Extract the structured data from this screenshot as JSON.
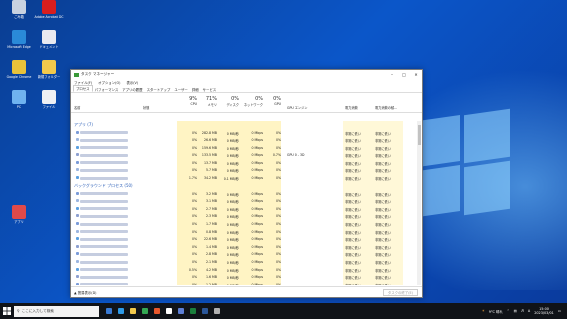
{
  "desktop": {
    "icons": [
      {
        "label": "ごみ箱",
        "color": "#c8d2e0"
      },
      {
        "label": "Adobe Acrobat DC",
        "color": "#d81e1e"
      },
      {
        "label": "Microsoft Edge",
        "color": "#2a8ad8"
      },
      {
        "label": "ドキュメント",
        "color": "#e9eaf0"
      },
      {
        "label": "Google Chrome",
        "color": "#e8c23a"
      },
      {
        "label": "新規フォルダー",
        "color": "#f2c94c"
      },
      {
        "label": "PC",
        "color": "#6fb3f0"
      },
      {
        "label": "アプリ",
        "color": "#e04a4a"
      },
      {
        "label": "ファイル",
        "color": "#eef0f4"
      }
    ]
  },
  "task_manager": {
    "title": "タスク マネージャー",
    "menu": [
      "ファイル(F)",
      "オプション(O)",
      "表示(V)"
    ],
    "tabs": [
      "プロセス",
      "パフォーマンス",
      "アプリの履歴",
      "スタートアップ",
      "ユーザー",
      "詳細",
      "サービス"
    ],
    "columns": {
      "name": "名前",
      "status": "状態",
      "cpu": {
        "pct": "9%",
        "label": "CPU"
      },
      "mem": {
        "pct": "71%",
        "label": "メモリ"
      },
      "disk": {
        "pct": "0%",
        "label": "ディスク"
      },
      "net": {
        "pct": "0%",
        "label": "ネットワーク"
      },
      "gpu": {
        "pct": "0%",
        "label": "GPU"
      },
      "gpu_engine": "GPU エンジン",
      "power": "電力消費",
      "power_trend": "電力消費の傾..."
    },
    "apps_section": "アプリ (7)",
    "bg_section": "バックグラウンド プロセス (50)",
    "app_rows": [
      {
        "cpu": "0%",
        "mem": "282.8 MB",
        "disk": "0 MB/秒",
        "net": "0 Mbps",
        "gpu": "0%",
        "engine": "",
        "power": "非常に低い",
        "trend": "非常に低い"
      },
      {
        "cpu": "0%",
        "mem": "26.6 MB",
        "disk": "0 MB/秒",
        "net": "0 Mbps",
        "gpu": "0%",
        "engine": "",
        "power": "非常に低い",
        "trend": "非常に低い"
      },
      {
        "cpu": "0%",
        "mem": "159.6 MB",
        "disk": "0 MB/秒",
        "net": "0 Mbps",
        "gpu": "0%",
        "engine": "",
        "power": "非常に低い",
        "trend": "非常に低い"
      },
      {
        "cpu": "0%",
        "mem": "133.5 MB",
        "disk": "0 MB/秒",
        "net": "0 Mbps",
        "gpu": "0.7%",
        "engine": "GPU 0 - 3D",
        "power": "非常に低い",
        "trend": "非常に低い"
      },
      {
        "cpu": "0%",
        "mem": "13.7 MB",
        "disk": "0 MB/秒",
        "net": "0 Mbps",
        "gpu": "0%",
        "engine": "",
        "power": "非常に低い",
        "trend": "非常に低い"
      },
      {
        "cpu": "0%",
        "mem": "5.7 MB",
        "disk": "0 MB/秒",
        "net": "0 Mbps",
        "gpu": "0%",
        "engine": "",
        "power": "非常に低い",
        "trend": "非常に低い"
      },
      {
        "cpu": "1.7%",
        "mem": "34.2 MB",
        "disk": "0.1 MB/秒",
        "net": "0 Mbps",
        "gpu": "0%",
        "engine": "",
        "power": "非常に低い",
        "trend": "非常に低い"
      }
    ],
    "bg_rows": [
      {
        "cpu": "0%",
        "mem": "3.2 MB",
        "disk": "0 MB/秒",
        "net": "0 Mbps",
        "gpu": "0%",
        "power": "非常に低い",
        "trend": "非常に低い"
      },
      {
        "cpu": "0%",
        "mem": "3.1 MB",
        "disk": "0 MB/秒",
        "net": "0 Mbps",
        "gpu": "0%",
        "power": "非常に低い",
        "trend": "非常に低い"
      },
      {
        "cpu": "0%",
        "mem": "2.7 MB",
        "disk": "0 MB/秒",
        "net": "0 Mbps",
        "gpu": "0%",
        "power": "非常に低い",
        "trend": "非常に低い"
      },
      {
        "cpu": "0%",
        "mem": "2.3 MB",
        "disk": "0 MB/秒",
        "net": "0 Mbps",
        "gpu": "0%",
        "power": "非常に低い",
        "trend": "非常に低い"
      },
      {
        "cpu": "0%",
        "mem": "1.7 MB",
        "disk": "0 MB/秒",
        "net": "0 Mbps",
        "gpu": "0%",
        "power": "非常に低い",
        "trend": "非常に低い"
      },
      {
        "cpu": "0%",
        "mem": "0.8 MB",
        "disk": "0 MB/秒",
        "net": "0 Mbps",
        "gpu": "0%",
        "power": "非常に低い",
        "trend": "非常に低い"
      },
      {
        "cpu": "0%",
        "mem": "22.6 MB",
        "disk": "0 MB/秒",
        "net": "0 Mbps",
        "gpu": "0%",
        "power": "非常に低い",
        "trend": "非常に低い"
      },
      {
        "cpu": "0%",
        "mem": "1.4 MB",
        "disk": "0 MB/秒",
        "net": "0 Mbps",
        "gpu": "0%",
        "power": "非常に低い",
        "trend": "非常に低い"
      },
      {
        "cpu": "0%",
        "mem": "2.8 MB",
        "disk": "0 MB/秒",
        "net": "0 Mbps",
        "gpu": "0%",
        "power": "非常に低い",
        "trend": "非常に低い"
      },
      {
        "cpu": "0%",
        "mem": "2.1 MB",
        "disk": "0 MB/秒",
        "net": "0 Mbps",
        "gpu": "0%",
        "power": "非常に低い",
        "trend": "非常に低い"
      },
      {
        "cpu": "0.5%",
        "mem": "4.2 MB",
        "disk": "0 MB/秒",
        "net": "0 Mbps",
        "gpu": "0%",
        "power": "非常に低い",
        "trend": "非常に低い"
      },
      {
        "cpu": "0%",
        "mem": "1.6 MB",
        "disk": "0 MB/秒",
        "net": "0 Mbps",
        "gpu": "0%",
        "power": "非常に低い",
        "trend": "非常に低い"
      },
      {
        "cpu": "0%",
        "mem": "1.2 MB",
        "disk": "0 MB/秒",
        "net": "0 Mbps",
        "gpu": "0%",
        "power": "非常に低い",
        "trend": "非常に低い"
      }
    ],
    "footer_less": "簡易表示(D)",
    "end_task": "タスクの終了(E)"
  },
  "taskbar": {
    "search_placeholder": "ここに入力して検索",
    "temp": "9°C 晴れ",
    "ime": "A",
    "time": "15:00",
    "date": "2023/03/01",
    "app_icon_colors": [
      "#3a7bd5",
      "#2e9ae8",
      "#f2c94c",
      "#34a853",
      "#e9582c",
      "#ffffff",
      "#5d7fd6",
      "#1a7f3c",
      "#2b579a",
      "#b0b0b0"
    ]
  }
}
